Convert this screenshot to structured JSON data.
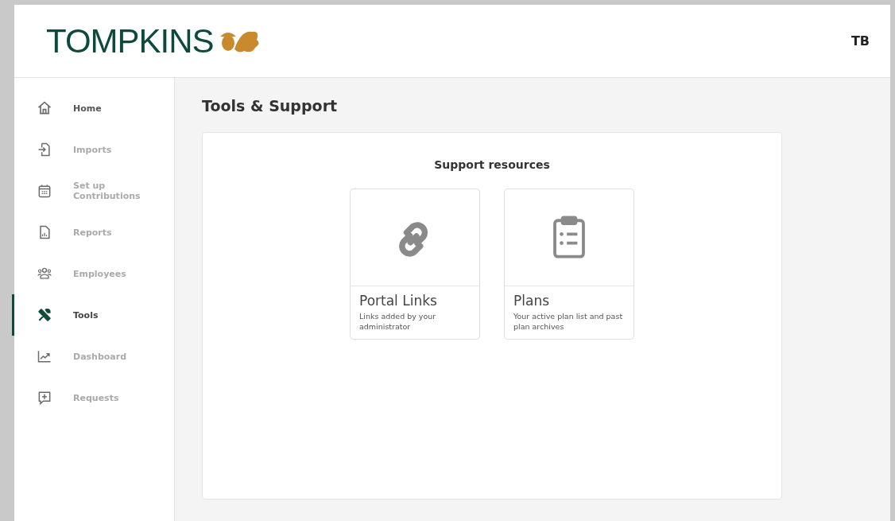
{
  "header": {
    "logo": "TOMPKINS",
    "user_initials": "TB"
  },
  "sidebar": {
    "items": [
      {
        "label": "Home",
        "selected": false
      },
      {
        "label": "Imports",
        "selected": false
      },
      {
        "label": "Set up Contributions",
        "selected": false
      },
      {
        "label": "Reports",
        "selected": false
      },
      {
        "label": "Employees",
        "selected": false
      },
      {
        "label": "Tools",
        "selected": true
      },
      {
        "label": "Dashboard",
        "selected": false
      },
      {
        "label": "Requests",
        "selected": false
      }
    ]
  },
  "page": {
    "title": "Tools & Support",
    "section_title": "Support resources",
    "tiles": [
      {
        "title": "Portal Links",
        "description": "Links added by your administrator"
      },
      {
        "title": "Plans",
        "description": "Your active plan list and past plan archives"
      }
    ]
  }
}
